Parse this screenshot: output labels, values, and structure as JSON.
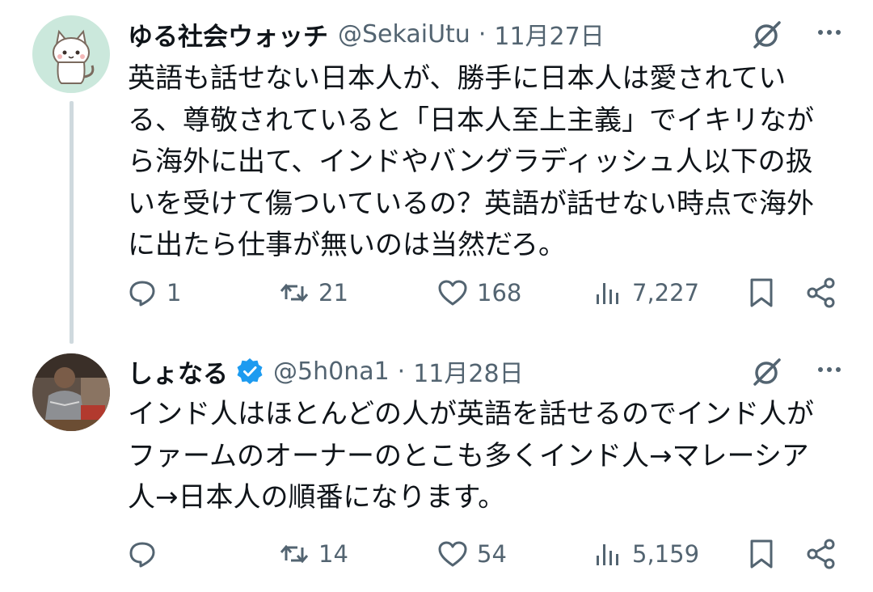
{
  "tweets": [
    {
      "display_name": "ゆる社会ウォッチ",
      "handle": "@SekaiUtu",
      "separator": "·",
      "date": "11月27日",
      "verified": false,
      "avatar_icon": "cat-avatar",
      "text": "英語も話せない日本人が、勝手に日本人は愛されてい\nる、尊敬されていると「日本人至上主義」でイキリなが\nら海外に出て、インドやバングラディッシュ人以下の扱\nいを受けて傷ついているの？英語が話せない時点で海外\nに出たら仕事が無いのは当然だろ。",
      "reply_count": "1",
      "retweet_count": "21",
      "like_count": "168",
      "view_count": "7,227"
    },
    {
      "display_name": "しょなる",
      "handle": "@5h0na1",
      "separator": "·",
      "date": "11月28日",
      "verified": true,
      "avatar_icon": "photo-avatar",
      "text": "インド人はほとんどの人が英語を話せるのでインド人が\nファームのオーナーのとこも多くインド人→マレーシア\n人→日本人の順番になります。",
      "reply_count": "",
      "retweet_count": "14",
      "like_count": "54",
      "view_count": "5,159"
    }
  ],
  "colors": {
    "text": "#0f1419",
    "secondary": "#536471",
    "verified_blue": "#1d9bf0",
    "thread_line": "#cfd9de",
    "avatar1_bg": "#cbe8dc"
  }
}
